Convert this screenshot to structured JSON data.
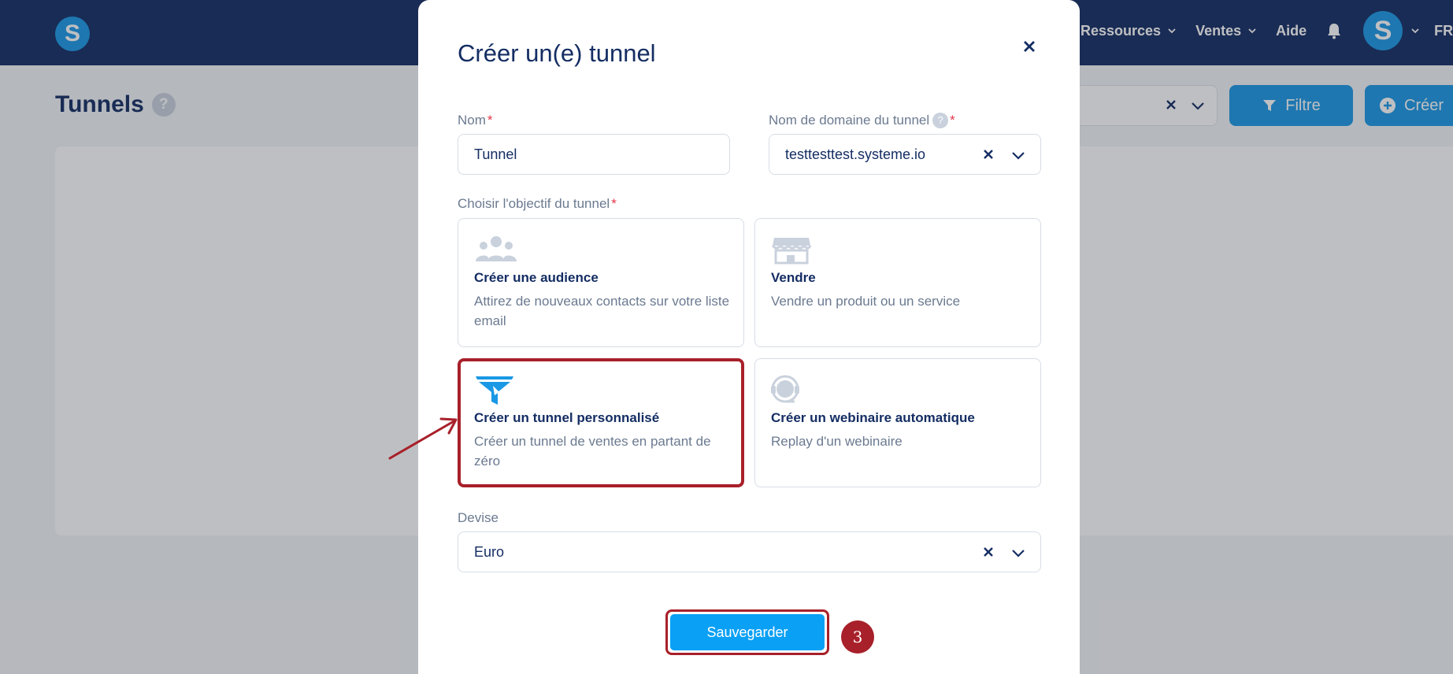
{
  "nav": {
    "logo": "S",
    "items": [
      {
        "label": "Ressources"
      },
      {
        "label": "Ventes"
      },
      {
        "label": "Aide"
      }
    ],
    "avatar": "S",
    "language": "FR"
  },
  "page": {
    "title": "Tunnels",
    "help": "?",
    "filter_label": "Filtre",
    "create_label": "Créer"
  },
  "modal": {
    "title": "Créer un(e) tunnel",
    "name_label": "Nom",
    "name_value": "Tunnel",
    "domain_label": "Nom de domaine du tunnel",
    "domain_value": "testtesttest.systeme.io",
    "objective_label": "Choisir l'objectif du tunnel",
    "objectives": [
      {
        "title": "Créer une audience",
        "desc": "Attirez de nouveaux contacts sur votre liste email",
        "icon": "audience-icon"
      },
      {
        "title": "Vendre",
        "desc": "Vendre un produit ou un service",
        "icon": "shop-icon"
      },
      {
        "title": "Créer un tunnel personnalisé",
        "desc": "Créer un tunnel de ventes en partant de zéro",
        "icon": "funnel-icon",
        "selected": true
      },
      {
        "title": "Créer un webinaire automatique",
        "desc": "Replay d'un webinaire",
        "icon": "webinar-icon"
      }
    ],
    "currency_label": "Devise",
    "currency_value": "Euro",
    "save_label": "Sauvegarder"
  },
  "annotation": {
    "step": "3"
  },
  "colors": {
    "nav_bg": "#142d63",
    "primary": "#1a98e5",
    "highlight": "#a8202a"
  }
}
